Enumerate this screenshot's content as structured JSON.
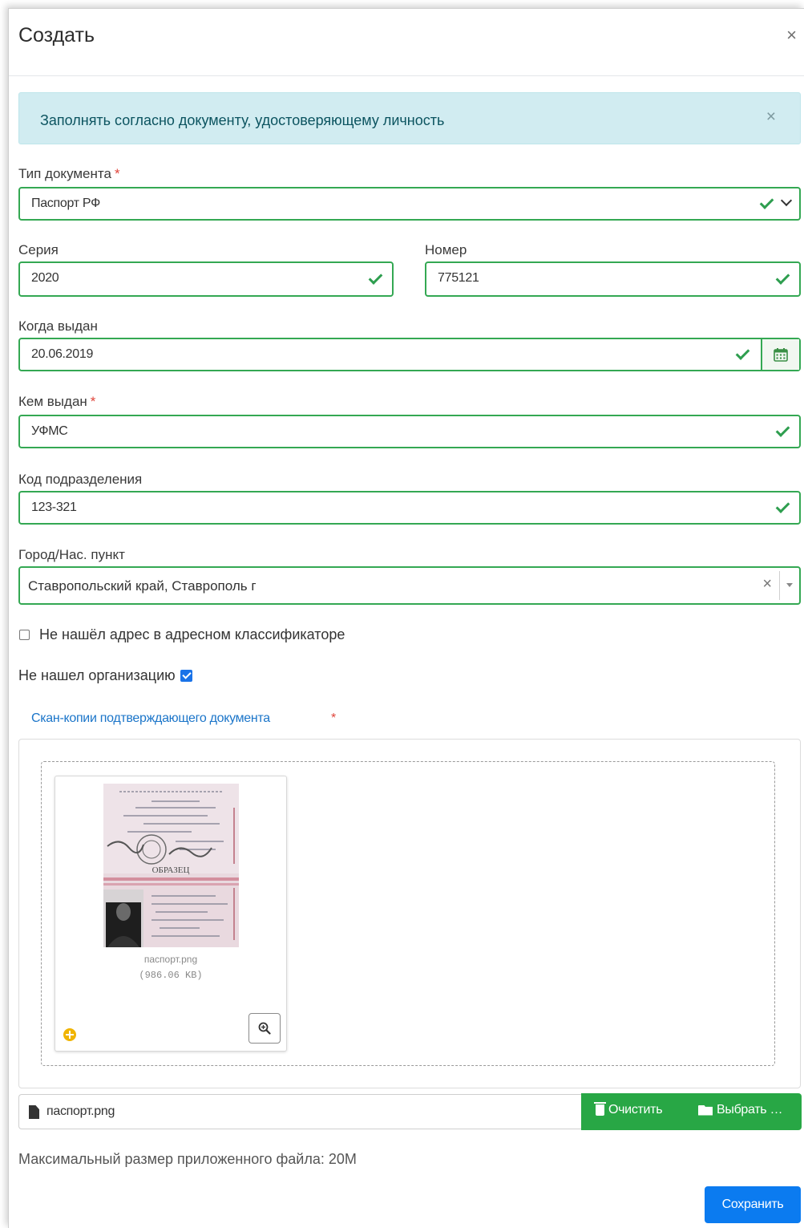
{
  "modal": {
    "title": "Создать",
    "close_symbol": "×"
  },
  "alert": {
    "text": "Заполнять согласно документу, удостоверяющему личность",
    "close_symbol": "×"
  },
  "fields": {
    "doc_type": {
      "label": "Тип документа",
      "required_mark": "*",
      "value": "Паспорт РФ",
      "icon": "chevron-down-icon"
    },
    "series": {
      "label": "Серия",
      "value": "2020"
    },
    "number": {
      "label": "Номер",
      "value": "775121"
    },
    "issued_date": {
      "label": "Когда выдан",
      "value": "20.06.2019",
      "icon": "calendar-icon"
    },
    "issued_by": {
      "label": "Кем выдан",
      "required_mark": "*",
      "value": "УФМС"
    },
    "division_code": {
      "label": "Код подразделения",
      "value": "123-321"
    },
    "city": {
      "label": "Город/Нас. пункт",
      "value": "Ставропольский край, Ставрополь г",
      "clear_symbol": "×"
    }
  },
  "checkboxes": {
    "address_not_found": {
      "label": "Не нашёл адрес в адресном классификаторе",
      "checked": false
    },
    "org_not_found": {
      "label": "Не нашел организацию",
      "checked": true
    }
  },
  "upload": {
    "label": "Скан-копии подтверждающего документа",
    "required_mark": "*",
    "preview": {
      "file_name": "паспорт.png",
      "file_size": "(986.06 KB)",
      "image_caption": "ОБРАЗЕЦ"
    },
    "caption_file_name": "паспорт.png",
    "clear_label": "Очистить",
    "browse_label": "Выбрать …",
    "max_size_text": "Максимальный размер приложенного файла: 20M"
  },
  "footer": {
    "save_label": "Сохранить"
  },
  "colors": {
    "valid_border": "#34a853",
    "alert_bg": "#d1ecf1",
    "primary": "#0b7bf0",
    "success": "#28a745",
    "required": "#e0443a",
    "link": "#1b75c9"
  }
}
